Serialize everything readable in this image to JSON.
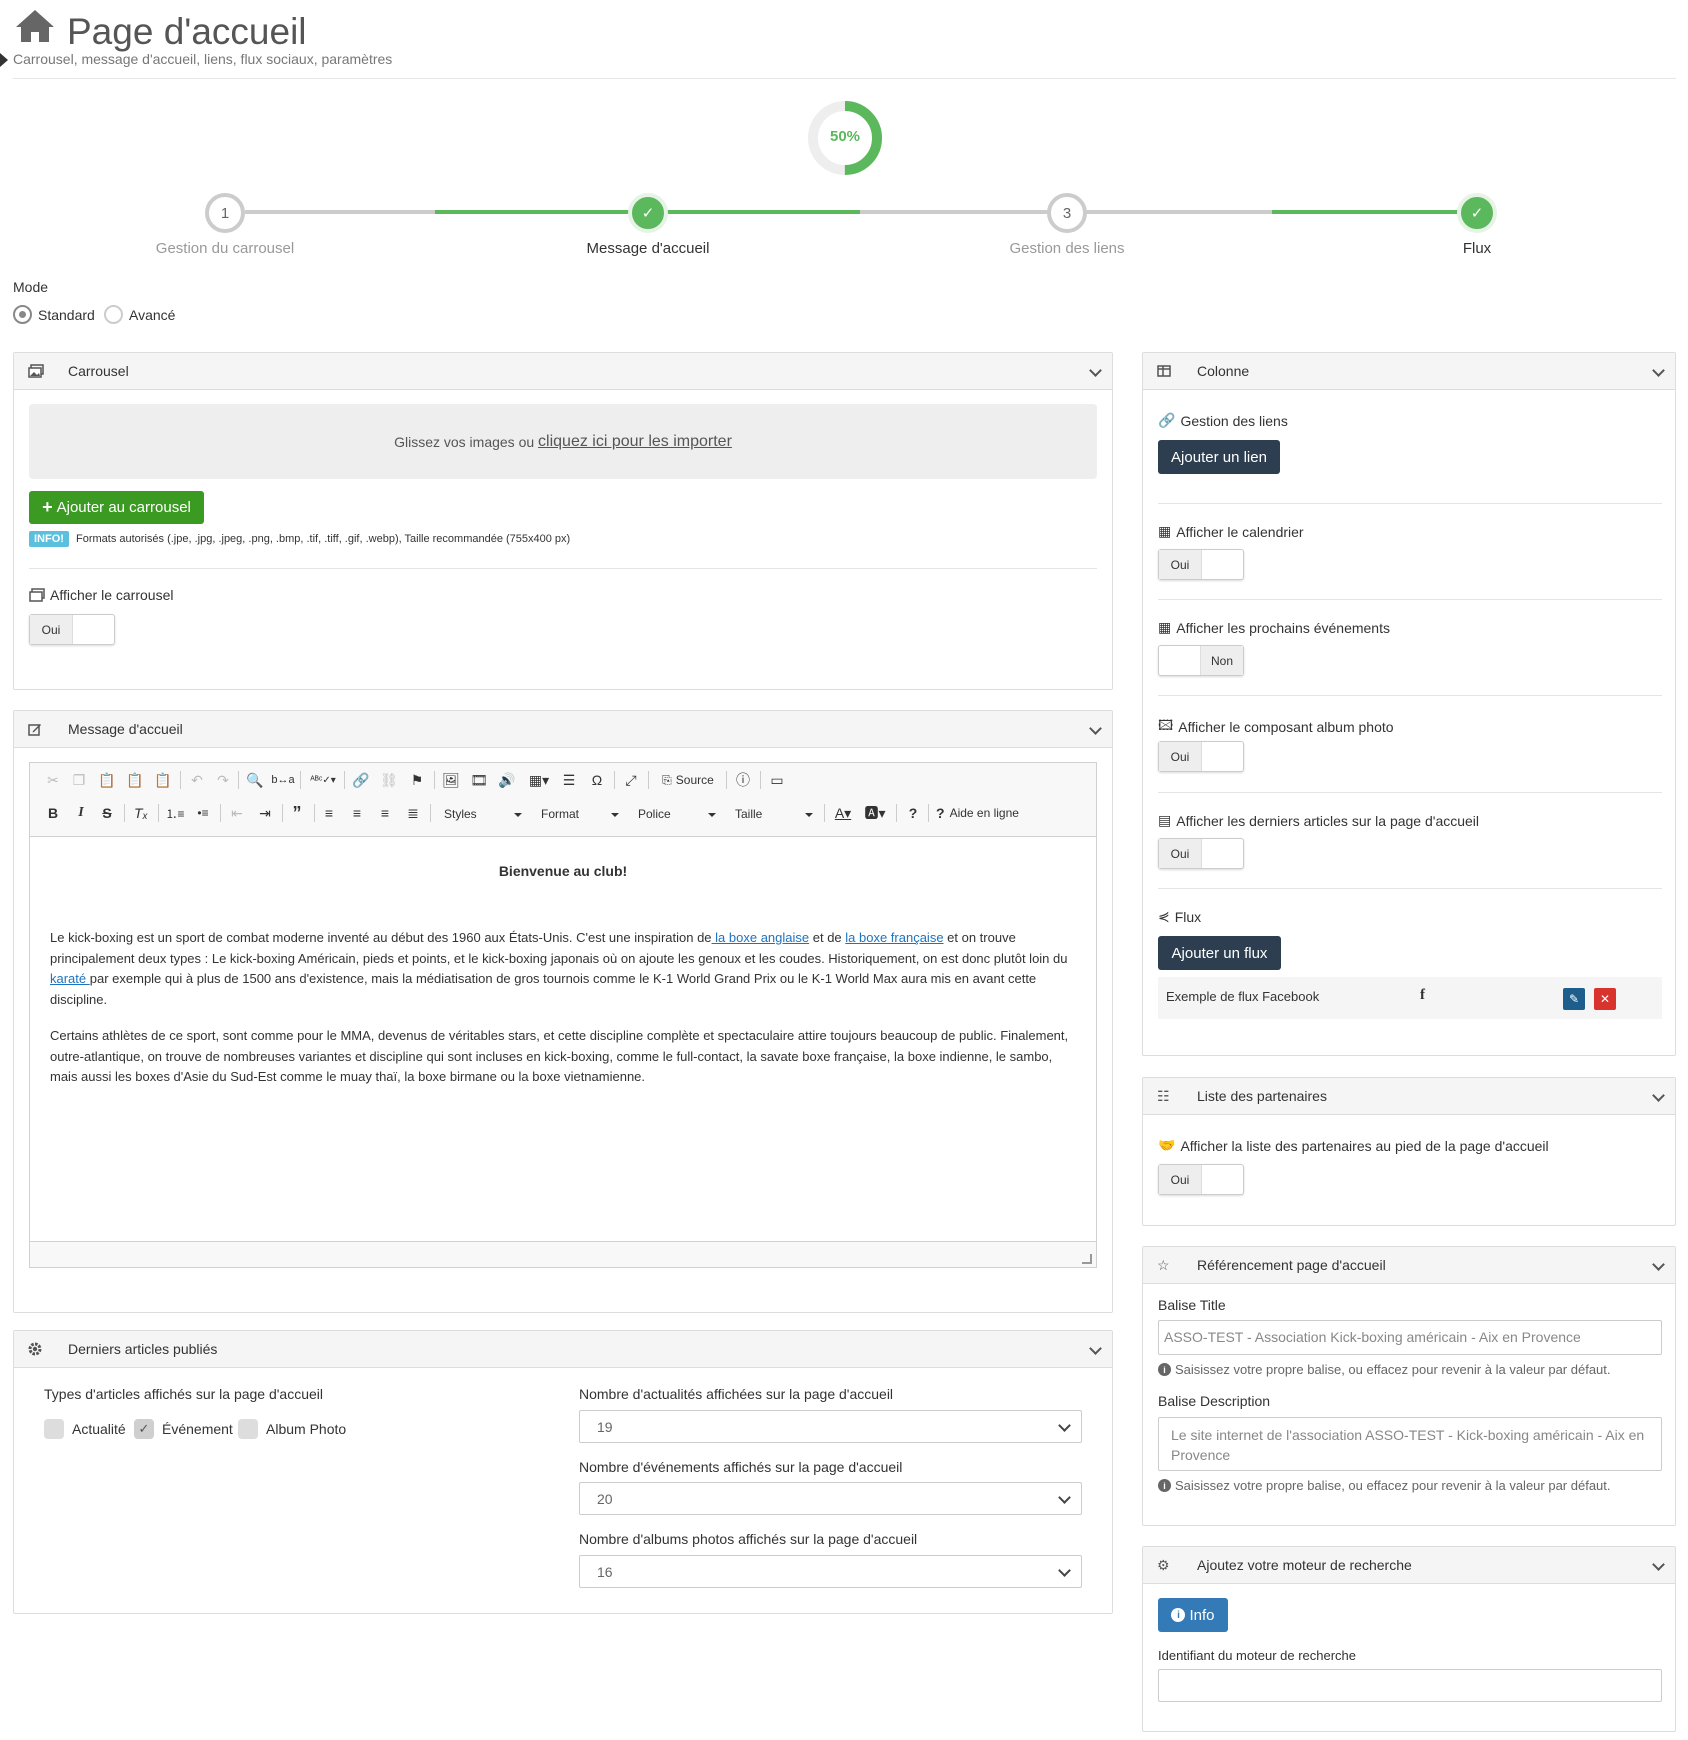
{
  "page": {
    "title": "Page d'accueil",
    "subtitle": "Carrousel, message d'accueil, liens, flux sociaux, paramètres"
  },
  "progress": {
    "percent_label": "50%",
    "value": 0.5
  },
  "steps": [
    {
      "number": "1",
      "label": "Gestion du carrousel",
      "done": false
    },
    {
      "number": "",
      "label": "Message d'accueil",
      "done": true
    },
    {
      "number": "3",
      "label": "Gestion des liens",
      "done": false
    },
    {
      "number": "",
      "label": "Flux",
      "done": true
    }
  ],
  "mode": {
    "label": "Mode",
    "options": [
      "Standard",
      "Avancé"
    ],
    "selected": "Standard"
  },
  "carousel": {
    "header": "Carrousel",
    "drop_text": "Glissez vos images ou",
    "drop_link": "cliquez ici pour les importer",
    "add_button": "Ajouter au carrousel",
    "info_badge": "INFO!",
    "info_text": "Formats autorisés (.jpe, .jpg, .jpeg, .png, .bmp, .tif, .tiff, .gif, .webp), Taille recommandée (755x400 px)",
    "show_label": "Afficher le carrousel",
    "show_value": "Oui"
  },
  "welcome": {
    "header": "Message d'accueil",
    "toolbar": {
      "source": "Source",
      "styles": "Styles",
      "format": "Format",
      "font": "Police",
      "size": "Taille",
      "help": "Aide en ligne"
    },
    "heading": "Bienvenue au club!",
    "p1_a": "Le kick-boxing est un sport de combat moderne inventé au début des 1960 aux États-Unis. C'est une inspiration de",
    "p1_link1": " la boxe anglaise",
    "p1_b": " et de ",
    "p1_link2": "la boxe française",
    "p1_c": " et on trouve principalement deux types : Le kick-boxing Américain, pieds et points, et le kick-boxing japonais où on ajoute les genoux et les coudes. Historiquement, on est donc plutôt loin du",
    "p1_link3": " karaté ",
    "p1_d": "par exemple qui à plus de 1500 ans d'existence, mais la médiatisation de gros tournois comme le K-1 World Grand Prix ou le K-1 World Max aura mis en avant cette discipline.",
    "p2": "Certains athlètes de ce sport, sont comme pour le MMA, devenus de véritables stars, et cette discipline complète et spectaculaire attire toujours beaucoup de public. Finalement, outre-atlantique, on trouve de nombreuses variantes et discipline qui sont incluses en kick-boxing, comme le full-contact, la savate boxe française, la boxe indienne, le sambo, mais aussi les boxes d'Asie du Sud-Est comme le muay thaï, la boxe birmane ou la boxe vietnamienne."
  },
  "articles": {
    "header": "Derniers articles publiés",
    "types_label": "Types d'articles affichés sur la page d'accueil",
    "types": [
      {
        "label": "Actualité",
        "checked": false
      },
      {
        "label": "Événement",
        "checked": true
      },
      {
        "label": "Album Photo",
        "checked": false
      }
    ],
    "news_label": "Nombre d'actualités affichées sur la page d'accueil",
    "news_value": "19",
    "events_label": "Nombre d'événements affichés sur la page d'accueil",
    "events_value": "20",
    "albums_label": "Nombre d'albums photos affichés sur la page d'accueil",
    "albums_value": "16"
  },
  "column": {
    "header": "Colonne",
    "links_label": "Gestion des liens",
    "add_link": "Ajouter un lien",
    "calendar_label": "Afficher le calendrier",
    "calendar_value": "Oui",
    "events_label": "Afficher les prochains événements",
    "events_value": "Non",
    "album_label": "Afficher le composant album photo",
    "album_value": "Oui",
    "articles_label": "Afficher les derniers articles sur la page d'accueil",
    "articles_value": "Oui",
    "flux_label": "Flux",
    "add_flux": "Ajouter un flux",
    "flux_rows": [
      {
        "name": "Exemple de flux Facebook",
        "icon": "facebook-icon"
      }
    ]
  },
  "partners": {
    "header": "Liste des partenaires",
    "show_label": "Afficher la liste des partenaires au pied de la page d'accueil",
    "show_value": "Oui"
  },
  "seo": {
    "header": "Référencement page d'accueil",
    "title_label": "Balise Title",
    "title_placeholder": "ASSO-TEST - Association Kick-boxing américain - Aix en Provence",
    "help": "Saisissez votre propre balise, ou effacez pour revenir à la valeur par défaut.",
    "desc_label": "Balise Description",
    "desc_placeholder": "Le site internet de l'association ASSO-TEST - Kick-boxing américain - Aix en Provence"
  },
  "search_engine": {
    "header": "Ajoutez votre moteur de recherche",
    "info_button": "Info",
    "id_label": "Identifiant du moteur de recherche",
    "id_value": ""
  },
  "colors": {
    "green": "#5cb85c",
    "navy": "#2d3e50",
    "add_green": "#3a9a22",
    "info_blue": "#337ab7",
    "badge_cyan": "#5bc0de",
    "danger": "#d9332e"
  }
}
